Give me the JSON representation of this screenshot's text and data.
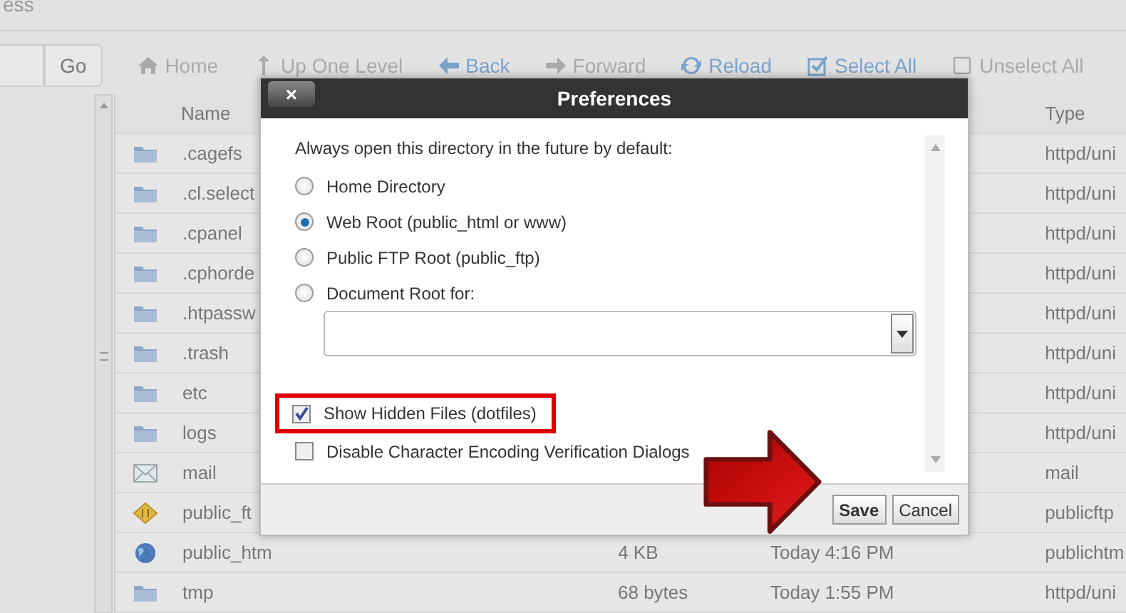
{
  "page_title": "ess",
  "toolbar": {
    "go": "Go",
    "items": [
      {
        "kind": "home",
        "label": "Home",
        "disabled": true
      },
      {
        "kind": "up",
        "label": "Up One Level",
        "disabled": true
      },
      {
        "kind": "back",
        "label": "Back",
        "disabled": false
      },
      {
        "kind": "forward",
        "label": "Forward",
        "disabled": true
      },
      {
        "kind": "reload",
        "label": "Reload",
        "disabled": false
      },
      {
        "kind": "selectall",
        "label": "Select All",
        "disabled": false
      },
      {
        "kind": "unselectall",
        "label": "Unselect All",
        "disabled": true
      }
    ]
  },
  "table": {
    "columns": [
      "Name",
      "Type"
    ],
    "rows": [
      {
        "kind": "folder",
        "name": ".cagefs",
        "type": "httpd/uni"
      },
      {
        "kind": "folder",
        "name": ".cl.select",
        "type": "httpd/uni"
      },
      {
        "kind": "folder",
        "name": ".cpanel",
        "type": "httpd/uni"
      },
      {
        "kind": "folder",
        "name": ".cphorde",
        "type": "httpd/uni"
      },
      {
        "kind": "folder",
        "name": ".htpassw",
        "type": "httpd/uni"
      },
      {
        "kind": "folder",
        "name": ".trash",
        "type": "httpd/uni"
      },
      {
        "kind": "folder",
        "name": "etc",
        "type": "httpd/uni"
      },
      {
        "kind": "folder",
        "name": "logs",
        "type": "httpd/uni"
      },
      {
        "kind": "mail",
        "name": "mail",
        "type": "mail"
      },
      {
        "kind": "ftp",
        "name": "public_ft",
        "type": "publicftp"
      },
      {
        "kind": "web",
        "name": "public_htm",
        "size": "4 KB",
        "date": "Today 4:16 PM",
        "type": "publichtm"
      },
      {
        "kind": "folder",
        "name": "tmp",
        "size": "68 bytes",
        "date": "Today 1:55 PM",
        "type": "httpd/uni"
      }
    ]
  },
  "dialog": {
    "title": "Preferences",
    "close": "×",
    "intro": "Always open this directory in the future by default:",
    "radios": [
      {
        "label": "Home Directory",
        "selected": false
      },
      {
        "label": "Web Root (public_html or www)",
        "selected": true
      },
      {
        "label": "Public FTP Root (public_ftp)",
        "selected": false
      },
      {
        "label": "Document Root for:",
        "selected": false
      }
    ],
    "checks": [
      {
        "label": "Show Hidden Files (dotfiles)",
        "checked": true,
        "highlighted": true
      },
      {
        "label": "Disable Character Encoding Verification Dialogs",
        "checked": false,
        "highlighted": false
      }
    ],
    "buttons": [
      {
        "label": "Save",
        "primary": true
      },
      {
        "label": "Cancel",
        "primary": false
      }
    ]
  }
}
